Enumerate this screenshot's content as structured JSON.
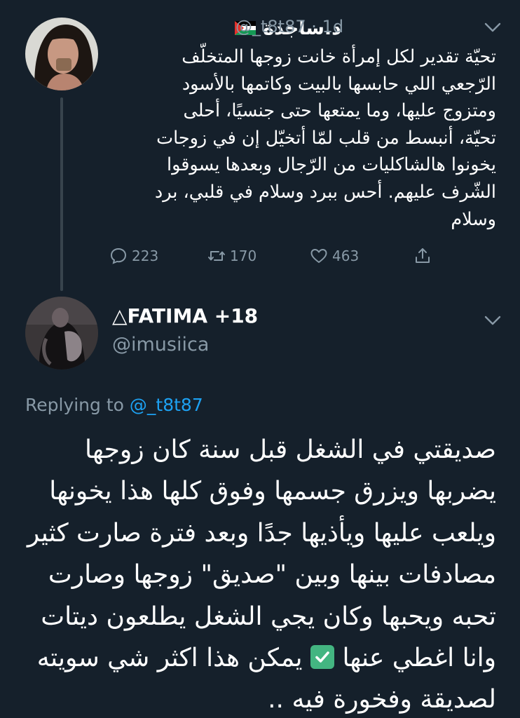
{
  "parent_tweet": {
    "author_name": "د.ساجدة",
    "flag": "palestine-flag",
    "handle": "@_t8t87",
    "separator": "·",
    "time": "1d",
    "text_lines": [
      "تحيّة تقدير لكل إمرأة خانت زوجها المتخلّف",
      "الرّجعي اللي حابسها بالبيت وكاتمها بالأسود",
      "ومتزوج عليها، وما يمتعها حتى جنسيًا، أحلى",
      "تحيّة، أنبسط من قلب لمّا أتخيّل إن في زوجات",
      "يخونوا هالشاكليات من الرّجال وبعدها يسوقوا",
      "الشّرف عليهم. أحس ببرد وسلام في قلبي، برد",
      "وسلام"
    ],
    "reply_count": "223",
    "retweet_count": "170",
    "like_count": "463"
  },
  "reply_tweet": {
    "author_name": "△FATIMA +18",
    "handle": "@imusiica",
    "replying_prefix": "Replying to",
    "replying_to": "@_t8t87",
    "text_lines": [
      "صديقتي في الشغل قبل سنة كان زوجها",
      "يضربها ويزرق جسمها وفوق كلها هذا يخونها",
      "ويلعب عليها ويأذيها جدًا وبعد فترة صارت كثير",
      "مصادفات بينها وبين \"صديق\" زوجها وصارت",
      "تحبه ويحبها وكان يجي الشغل يطلعون ديتات"
    ],
    "line6_before_emoji": "وانا اغطي عنها",
    "emoji": "white-check-mark",
    "line6_after_emoji": "يمكن هذا اكثر شي سويته",
    "line7": "لصديقة وفخورة فيه .."
  },
  "colors": {
    "background": "#15202b",
    "text": "#ffffff",
    "secondary": "#8899a6",
    "link": "#1da1f2",
    "thread_line": "#38444d"
  }
}
